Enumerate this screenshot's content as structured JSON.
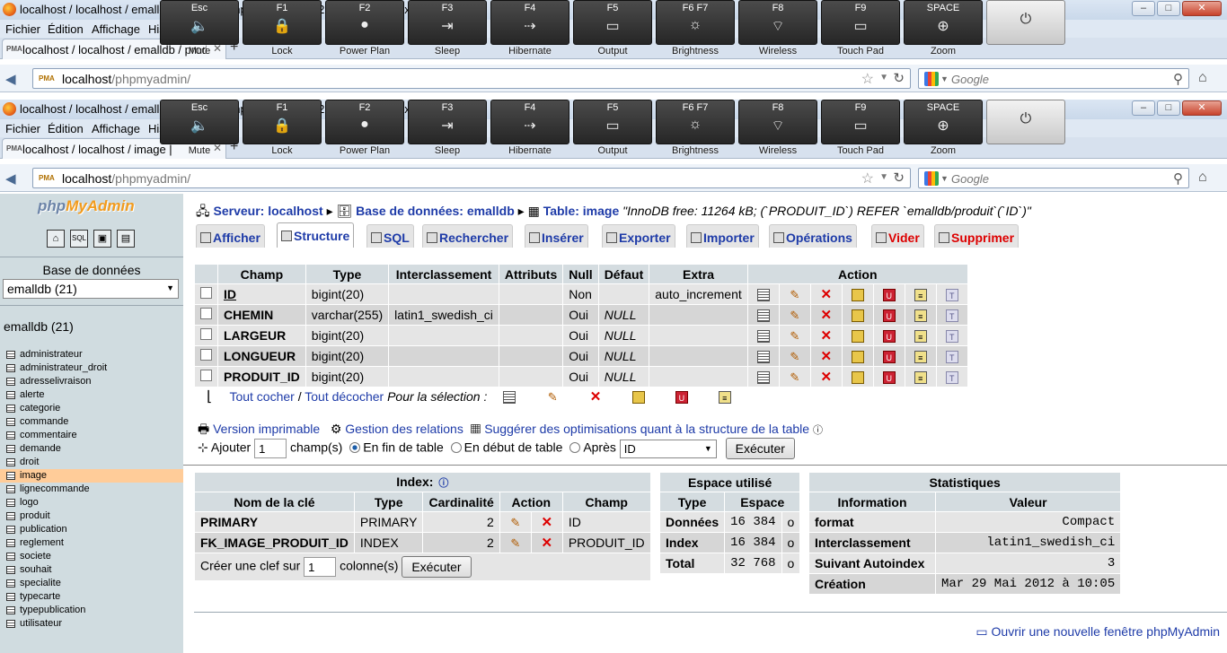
{
  "browser": {
    "window_title": "localhost / localhost / emalldb / produit | phpMyAdmin 3.3.2 - Mozilla Firefox",
    "menu": [
      "Fichier",
      "Édition",
      "Affichage",
      "Historique"
    ],
    "tab_title": "localhost / localhost / emalldb / produit",
    "tab_title2": "localhost / localhost / image |",
    "url_host": "localhost",
    "url_path": "/phpmyadmin/",
    "search_placeholder": "Google",
    "pma_badge": "PMA"
  },
  "fnkeys": [
    {
      "key": "Esc",
      "caption": "Mute",
      "glyph": "🔈"
    },
    {
      "key": "F1",
      "caption": "Lock",
      "glyph": "🔒"
    },
    {
      "key": "F2",
      "caption": "Power Plan",
      "glyph": "●"
    },
    {
      "key": "F3",
      "caption": "Sleep",
      "glyph": "⇥"
    },
    {
      "key": "F4",
      "caption": "Hibernate",
      "glyph": "⇢"
    },
    {
      "key": "F5",
      "caption": "Output",
      "glyph": "▭"
    },
    {
      "key": "F6 F7",
      "caption": "Brightness",
      "glyph": "☼"
    },
    {
      "key": "F8",
      "caption": "Wireless",
      "glyph": "⌔"
    },
    {
      "key": "F9",
      "caption": "Touch Pad",
      "glyph": "▭"
    },
    {
      "key": "SPACE",
      "caption": "Zoom",
      "glyph": "⊕"
    }
  ],
  "left": {
    "logo_a": "php",
    "logo_b": "MyAdmin",
    "db_label": "Base de données",
    "db_select": "emalldb (21)",
    "db_name": "emalldb (21)",
    "tables": [
      "administrateur",
      "administrateur_droit",
      "adresselivraison",
      "alerte",
      "categorie",
      "commande",
      "commentaire",
      "demande",
      "droit",
      "image",
      "lignecommande",
      "logo",
      "produit",
      "publication",
      "reglement",
      "societe",
      "souhait",
      "specialite",
      "typecarte",
      "typepublication",
      "utilisateur"
    ],
    "selected": "image",
    "nav_icons": [
      "home-icon",
      "sql-icon",
      "query-icon",
      "docs-icon"
    ]
  },
  "breadcrumb": {
    "server": "Serveur: localhost",
    "db": "Base de données: emalldb",
    "table": "Table: image",
    "comment": "\"InnoDB free: 11264 kB; (`PRODUIT_ID`) REFER `emalldb/produit`(`ID`)\""
  },
  "tabs": [
    {
      "label": "Afficher"
    },
    {
      "label": "Structure"
    },
    {
      "label": "SQL"
    },
    {
      "label": "Rechercher"
    },
    {
      "label": "Insérer"
    },
    {
      "label": "Exporter"
    },
    {
      "label": "Importer"
    },
    {
      "label": "Opérations"
    },
    {
      "label": "Vider"
    },
    {
      "label": "Supprimer"
    }
  ],
  "structure": {
    "headers": [
      "Champ",
      "Type",
      "Interclassement",
      "Attributs",
      "Null",
      "Défaut",
      "Extra",
      "Action"
    ],
    "rows": [
      {
        "champ": "ID",
        "type": "bigint(20)",
        "inter": "",
        "attr": "",
        "null": "Non",
        "defaut": "",
        "extra": "auto_increment"
      },
      {
        "champ": "CHEMIN",
        "type": "varchar(255)",
        "inter": "latin1_swedish_ci",
        "attr": "",
        "null": "Oui",
        "defaut": "NULL",
        "extra": ""
      },
      {
        "champ": "LARGEUR",
        "type": "bigint(20)",
        "inter": "",
        "attr": "",
        "null": "Oui",
        "defaut": "NULL",
        "extra": ""
      },
      {
        "champ": "LONGUEUR",
        "type": "bigint(20)",
        "inter": "",
        "attr": "",
        "null": "Oui",
        "defaut": "NULL",
        "extra": ""
      },
      {
        "champ": "PRODUIT_ID",
        "type": "bigint(20)",
        "inter": "",
        "attr": "",
        "null": "Oui",
        "defaut": "NULL",
        "extra": ""
      }
    ]
  },
  "selection": {
    "check_all": "Tout cocher",
    "sep": "/",
    "uncheck_all": "Tout décocher",
    "for_sel": "Pour la sélection :"
  },
  "links": {
    "print": "Version imprimable",
    "relations": "Gestion des relations",
    "suggest": "Suggérer des optimisations quant à la structure de la table"
  },
  "add": {
    "label": "Ajouter",
    "count": "1",
    "fields": "champ(s)",
    "end": "En fin de table",
    "start": "En début de table",
    "after": "Après",
    "after_field": "ID",
    "button": "Exécuter"
  },
  "index": {
    "caption": "Index:",
    "headers": [
      "Nom de la clé",
      "Type",
      "Cardinalité",
      "Action",
      "Champ"
    ],
    "rows": [
      {
        "name": "PRIMARY",
        "type": "PRIMARY",
        "card": "2",
        "champ": "ID"
      },
      {
        "name": "FK_IMAGE_PRODUIT_ID",
        "type": "INDEX",
        "card": "2",
        "champ": "PRODUIT_ID"
      }
    ],
    "create_label": "Créer une clef sur",
    "create_count": "1",
    "create_suffix": "colonne(s)",
    "button": "Exécuter"
  },
  "space": {
    "caption": "Espace utilisé",
    "headers": [
      "Type",
      "Espace"
    ],
    "rows": [
      {
        "type": "Données",
        "val": "16 384",
        "unit": "o"
      },
      {
        "type": "Index",
        "val": "16 384",
        "unit": "o"
      },
      {
        "type": "Total",
        "val": "32 768",
        "unit": "o"
      }
    ]
  },
  "stats": {
    "caption": "Statistiques",
    "headers": [
      "Information",
      "Valeur"
    ],
    "rows": [
      {
        "k": "format",
        "v": "Compact"
      },
      {
        "k": "Interclassement",
        "v": "latin1_swedish_ci"
      },
      {
        "k": "Suivant Autoindex",
        "v": "3"
      },
      {
        "k": "Création",
        "v": "Mar 29 Mai 2012 à 10:05"
      }
    ]
  },
  "new_window": "Ouvrir une nouvelle fenêtre phpMyAdmin"
}
